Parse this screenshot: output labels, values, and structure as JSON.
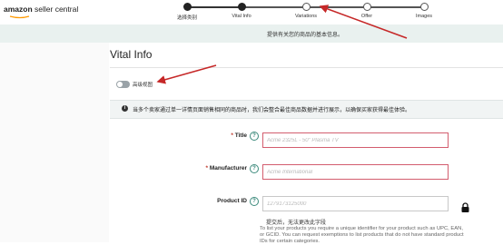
{
  "logo": {
    "brand": "amazon",
    "suffix": " seller central"
  },
  "stepper": {
    "steps": [
      {
        "label": "选择类别",
        "status": "done"
      },
      {
        "label": "Vital Info",
        "status": "done"
      },
      {
        "label": "Variations",
        "status": "todo"
      },
      {
        "label": "Offer",
        "status": "todo"
      },
      {
        "label": "Images",
        "status": "todo"
      }
    ]
  },
  "info_banner": "提供有关您的商品的基本信息。",
  "page_title": "Vital Info",
  "advanced_toggle": {
    "label": "高级视图",
    "on": false
  },
  "notice": {
    "icon": "info-icon",
    "text": "当多个卖家通过单一详情页面销售相同的商品时，我们会整合最佳商品数据并进行展示，以确保买家获得最佳体验。"
  },
  "fields": {
    "title": {
      "label": "Title",
      "required": "*",
      "placeholder": "Acme 2325L - 50\" Plasma TV"
    },
    "manufacturer": {
      "label": "Manufacturer",
      "required": "*",
      "placeholder": "Acme International"
    },
    "product_id": {
      "label": "Product ID",
      "placeholder": "1279173125000"
    }
  },
  "after_submit_note": "提交后，无法更改此字段",
  "product_id_help": "To list your products you require a unique identifier for your product such as UPC, EAN, or GCID. You can request exemptions to list products that do not have standard product IDs for certain categories.",
  "colors": {
    "accent": "#3c8a7c",
    "error_border": "#d35d6e",
    "annotation_arrow": "#c62828"
  }
}
